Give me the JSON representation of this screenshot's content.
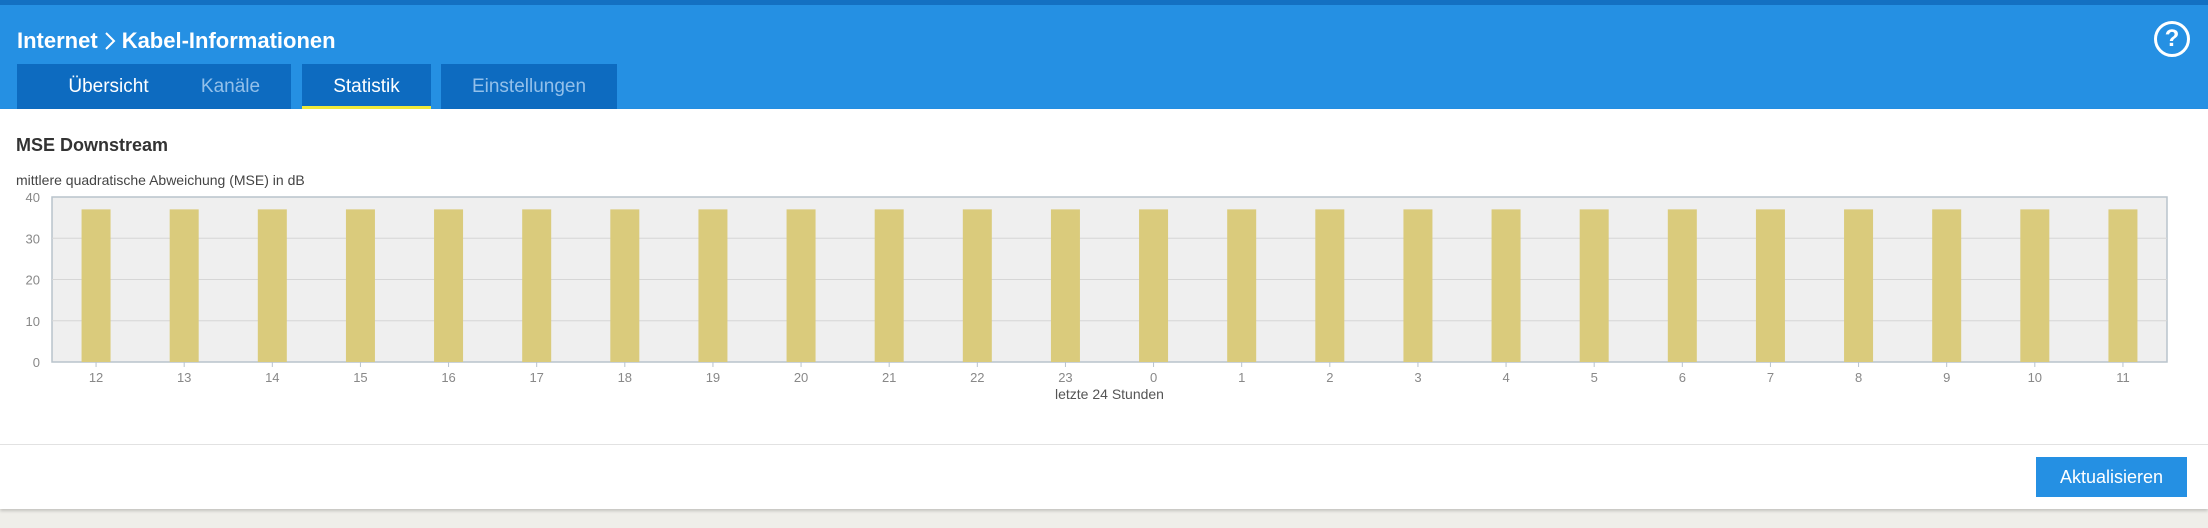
{
  "header": {
    "crumb_parent": "Internet",
    "crumb_current": "Kabel-Informationen",
    "help_symbol": "?"
  },
  "tabs": [
    {
      "label": "Übersicht",
      "state": "normal"
    },
    {
      "label": "Kanäle",
      "state": "muted"
    },
    {
      "label": "Statistik",
      "state": "active"
    },
    {
      "label": "Einstellungen",
      "state": "muted"
    }
  ],
  "section": {
    "title": "MSE Downstream",
    "subtitle": "mittlere quadratische Abweichung (MSE) in dB"
  },
  "actions": {
    "refresh_label": "Aktualisieren"
  },
  "colors": {
    "brand": "#2590e3",
    "tab": "#0d6bc0",
    "bar": "#dacb7c",
    "plot_bg": "#efefef"
  },
  "chart_data": {
    "type": "bar",
    "title": "MSE Downstream",
    "ylabel": "mittlere quadratische Abweichung (MSE) in dB",
    "xlabel": "letzte 24 Stunden",
    "categories": [
      "12",
      "13",
      "14",
      "15",
      "16",
      "17",
      "18",
      "19",
      "20",
      "21",
      "22",
      "23",
      "0",
      "1",
      "2",
      "3",
      "4",
      "5",
      "6",
      "7",
      "8",
      "9",
      "10",
      "11"
    ],
    "values": [
      37,
      37,
      37,
      37,
      37,
      37,
      37,
      37,
      37,
      37,
      37,
      37,
      37,
      37,
      37,
      37,
      37,
      37,
      37,
      37,
      37,
      37,
      37,
      37
    ],
    "ylim": [
      0,
      40
    ],
    "yticks": [
      0,
      10,
      20,
      30,
      40
    ],
    "grid": true
  }
}
